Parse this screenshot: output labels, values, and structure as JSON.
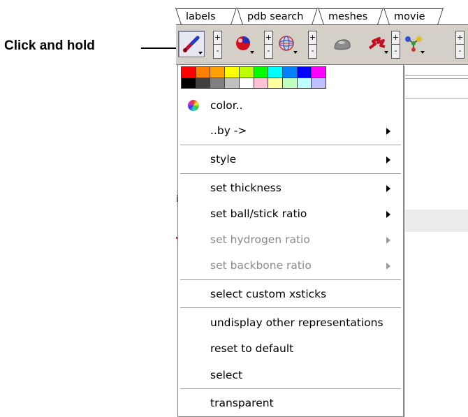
{
  "callout": {
    "text": "Click and hold"
  },
  "tabs": [
    "labels",
    "pdb search",
    "meshes",
    "movie"
  ],
  "toolbar": {
    "buttons": [
      {
        "name": "xsticks-button",
        "icon": "stick-icon",
        "pressed": true
      },
      {
        "name": "sphere-button",
        "icon": "sphere-icon"
      },
      {
        "name": "mesh-button",
        "icon": "mesh-sphere-icon"
      },
      {
        "name": "surface-button",
        "icon": "surface-icon"
      },
      {
        "name": "cartoon-button",
        "icon": "cartoon-icon"
      },
      {
        "name": "ballstick-button",
        "icon": "ball-stick-icon"
      }
    ],
    "plus_label": "+",
    "minus_label": "-"
  },
  "palette": {
    "row1": [
      "#ff0000",
      "#ff7f00",
      "#ff9f00",
      "#ffff00",
      "#bfff00",
      "#00ff00",
      "#00ffff",
      "#0080ff",
      "#0000ff",
      "#ff00ff"
    ],
    "row2": [
      "#000000",
      "#404040",
      "#808080",
      "#c0c0c0",
      "#ffffff",
      "#ffc0d8",
      "#ffff9f",
      "#c0ffc0",
      "#c0ffff",
      "#c0c0ff"
    ]
  },
  "menu": {
    "color": "color..",
    "by": "..by ->",
    "style": "style",
    "set_thickness": "set thickness",
    "set_ball_stick_ratio": "set ball/stick ratio",
    "set_hydrogen_ratio": "set hydrogen ratio",
    "set_backbone_ratio": "set backbone ratio",
    "select_custom_xsticks": "select custom xsticks",
    "undisplay_other": "undisplay other representations",
    "reset_to_default": "reset to default",
    "select": "select",
    "transparent": "transparent"
  },
  "background": {
    "fragment": "i"
  }
}
